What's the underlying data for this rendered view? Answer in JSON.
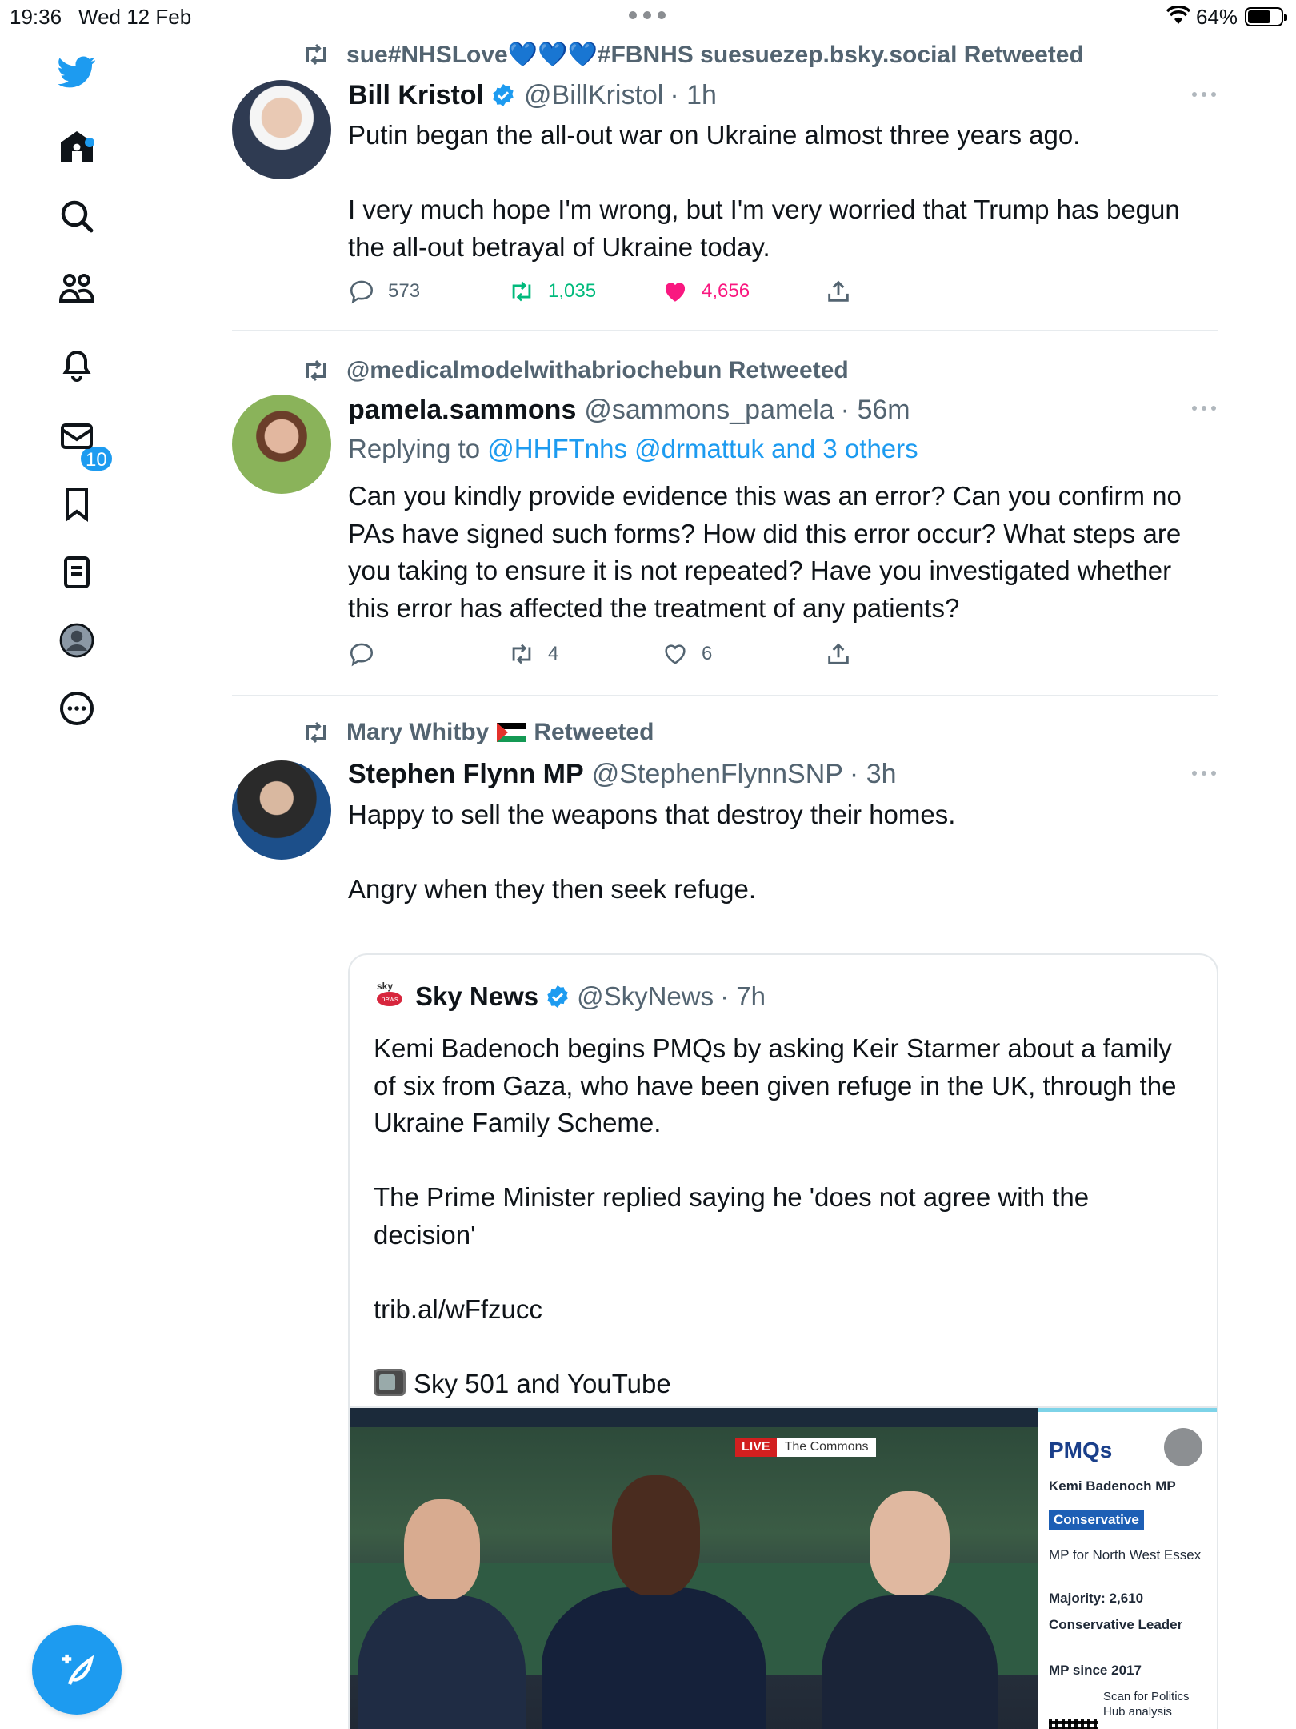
{
  "status_bar": {
    "time": "19:36",
    "date": "Wed 12 Feb",
    "battery": "64%"
  },
  "sidebar": {
    "notifications_badge": "10",
    "items": [
      "home",
      "search",
      "communities",
      "notifications",
      "messages",
      "bookmarks",
      "lists",
      "profile",
      "more"
    ]
  },
  "tweets": [
    {
      "retweeted_by": "sue#NHSLove💙💙💙#FBNHS suesuezep.bsky.social Retweeted",
      "name": "Bill Kristol",
      "handle": "@BillKristol",
      "time": "· 1h",
      "verified": true,
      "paragraphs": [
        "Putin began the all-out war on Ukraine almost three years ago.",
        "",
        "I very much hope I'm wrong, but I'm very worried that Trump has begun the all-out betrayal of Ukraine today."
      ],
      "replies": "573",
      "retweets": "1,035",
      "likes": "4,656"
    },
    {
      "retweeted_by": "@medicalmodelwithabriochebun Retweeted",
      "name": "pamela.sammons",
      "handle": "@sammons_pamela",
      "time": "· 56m",
      "replying_prefix": "Replying to",
      "replying_to": "@HHFTnhs @drmattuk and 3 others",
      "paragraphs": [
        "Can you kindly provide evidence this was an error? Can you confirm no PAs have signed such forms? How did this error occur? What steps are you taking to ensure it is not repeated? Have you investigated whether this error has affected the treatment of any patients?"
      ],
      "replies": "",
      "retweets": "4",
      "likes": "6"
    },
    {
      "retweeted_by": "Mary Whitby",
      "retweeted_suffix": "Retweeted",
      "name": "Stephen Flynn MP",
      "handle": "@StephenFlynnSNP",
      "time": "· 3h",
      "paragraphs": [
        "Happy to sell the weapons that destroy their homes.",
        "",
        "Angry when they then seek refuge."
      ],
      "quote": {
        "logo_top": "sky",
        "logo_bottom": "news",
        "name": "Sky News",
        "handle": "@SkyNews",
        "time": "· 7h",
        "verified": true,
        "paragraphs": [
          "Kemi Badenoch begins PMQs by asking Keir Starmer about a family of six from Gaza, who have been given refuge in the UK, through the Ukraine Family Scheme.",
          "",
          "The Prime Minister replied saying he 'does not agree with the decision'",
          "",
          "trib.al/wFfzucc",
          "",
          "Sky 501 and YouTube"
        ],
        "media": {
          "live": "LIVE",
          "location": "The Commons",
          "panel_title": "PMQs",
          "speaker": "Kemi Badenoch MP",
          "party": "Conservative",
          "constituency": "MP for North West Essex",
          "majority": "Majority: 2,610",
          "role": "Conservative Leader",
          "since": "MP since 2017",
          "scan": "Scan for Politics Hub analysis"
        }
      }
    }
  ]
}
